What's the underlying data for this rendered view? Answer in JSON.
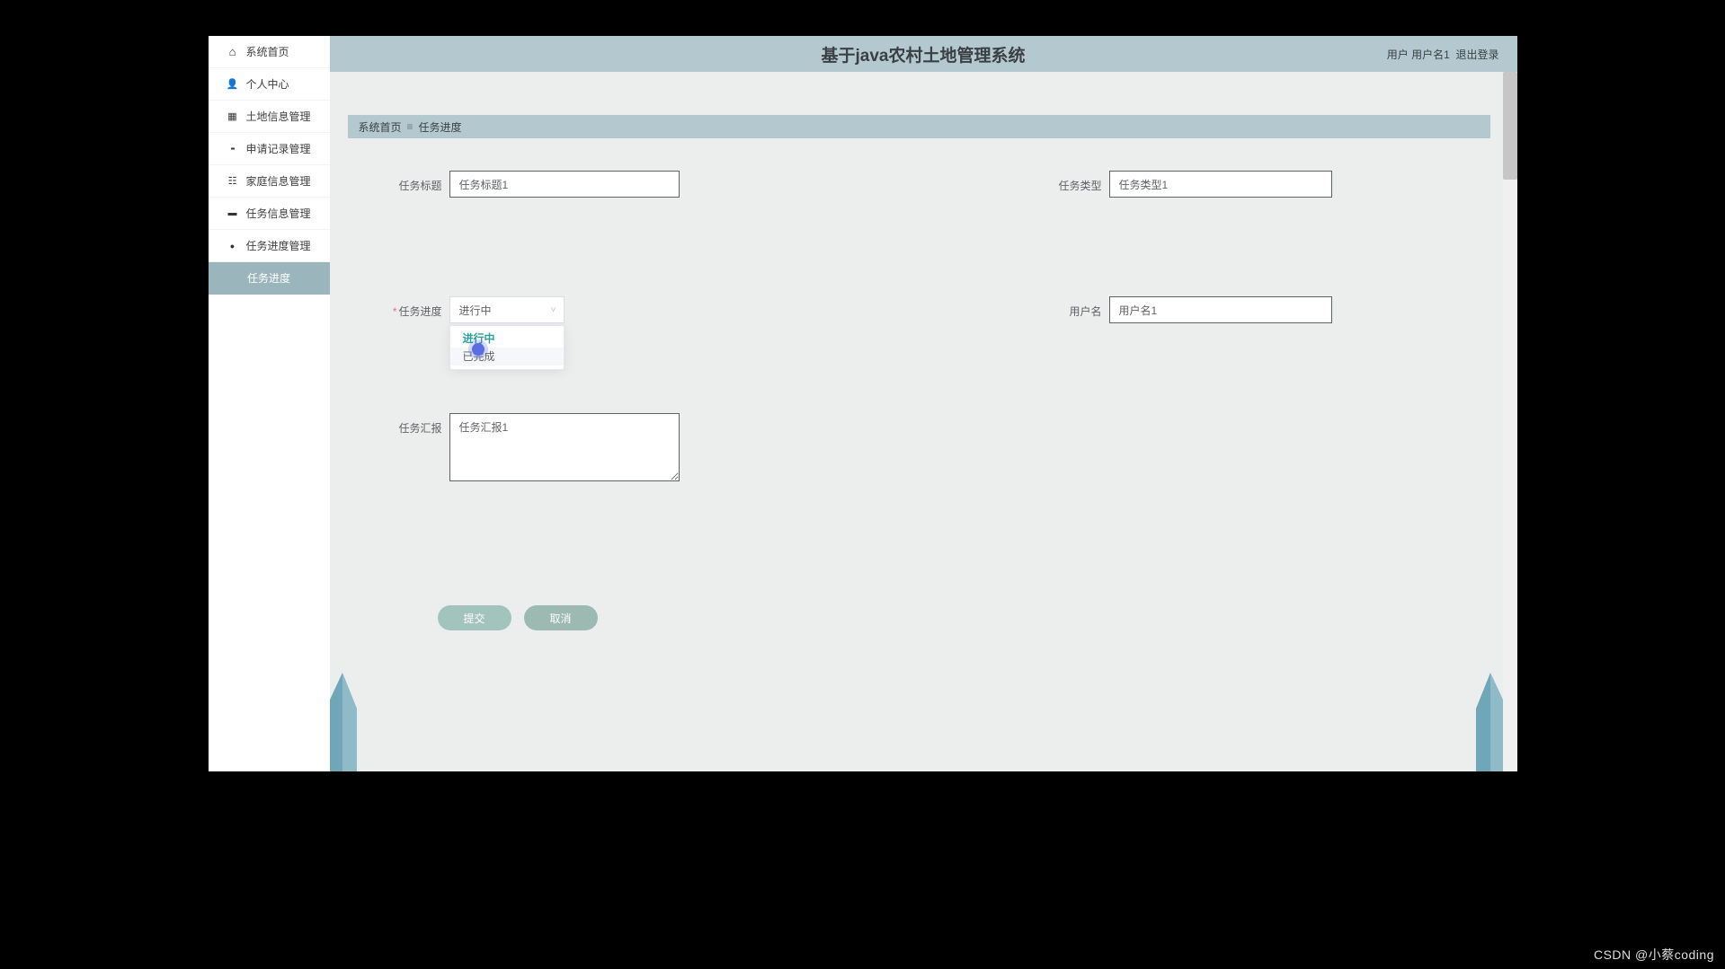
{
  "header": {
    "title": "基于java农村土地管理系统",
    "user_label": "用户",
    "username": "用户名1",
    "logout": "退出登录"
  },
  "sidebar": {
    "items": [
      {
        "label": "系统首页",
        "icon": "home-icon"
      },
      {
        "label": "个人中心",
        "icon": "user-icon"
      },
      {
        "label": "土地信息管理",
        "icon": "land-icon"
      },
      {
        "label": "申请记录管理",
        "icon": "record-icon"
      },
      {
        "label": "家庭信息管理",
        "icon": "family-icon"
      },
      {
        "label": "任务信息管理",
        "icon": "task-icon"
      },
      {
        "label": "任务进度管理",
        "icon": "progress-icon"
      }
    ],
    "active_subitem": "任务进度"
  },
  "breadcrumb": {
    "home": "系统首页",
    "current": "任务进度"
  },
  "form": {
    "task_title": {
      "label": "任务标题",
      "value": "任务标题1"
    },
    "task_type": {
      "label": "任务类型",
      "value": "任务类型1"
    },
    "task_progress": {
      "label": "任务进度",
      "required": true,
      "value": "进行中"
    },
    "username": {
      "label": "用户名",
      "value": "用户名1"
    },
    "task_report": {
      "label": "任务汇报",
      "value": "任务汇报1"
    }
  },
  "dropdown": {
    "options": [
      {
        "label": "进行中",
        "selected": true
      },
      {
        "label": "已完成",
        "selected": false
      }
    ]
  },
  "buttons": {
    "submit": "提交",
    "cancel": "取消"
  },
  "watermark": "CSDN @小蔡coding"
}
